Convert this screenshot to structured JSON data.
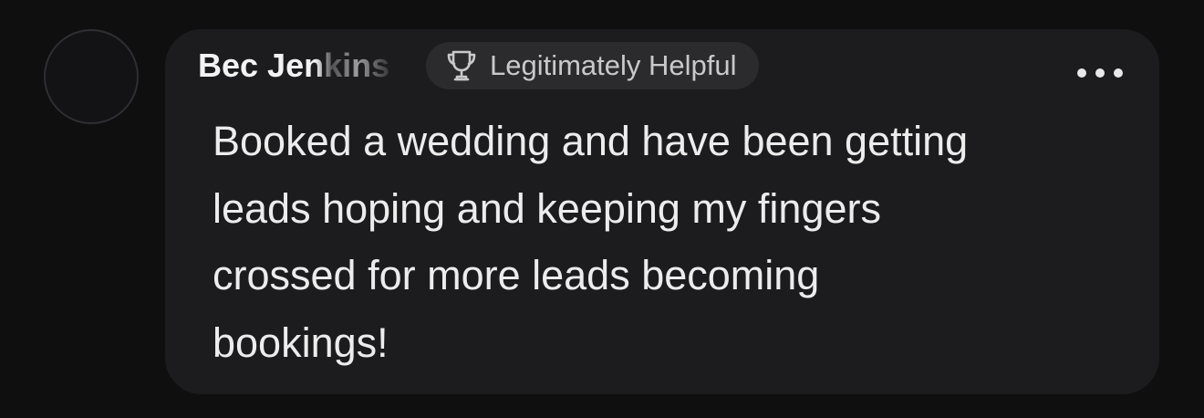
{
  "comment": {
    "author_name": "Bec Jenkins",
    "badge": {
      "icon": "trophy-icon",
      "label": "Legitimately Helpful"
    },
    "more_icon": "more-options-icon",
    "text_lines": [
      "Booked a wedding and have been getting",
      "leads hoping and keeping my fingers",
      "crossed for more leads becoming",
      "bookings!"
    ]
  },
  "colors": {
    "page_background": "#0f0f10",
    "bubble_background": "#1c1c1e",
    "badge_background": "#2b2b2d",
    "text_primary": "#ececec",
    "text_secondary": "#c9c9cc"
  }
}
